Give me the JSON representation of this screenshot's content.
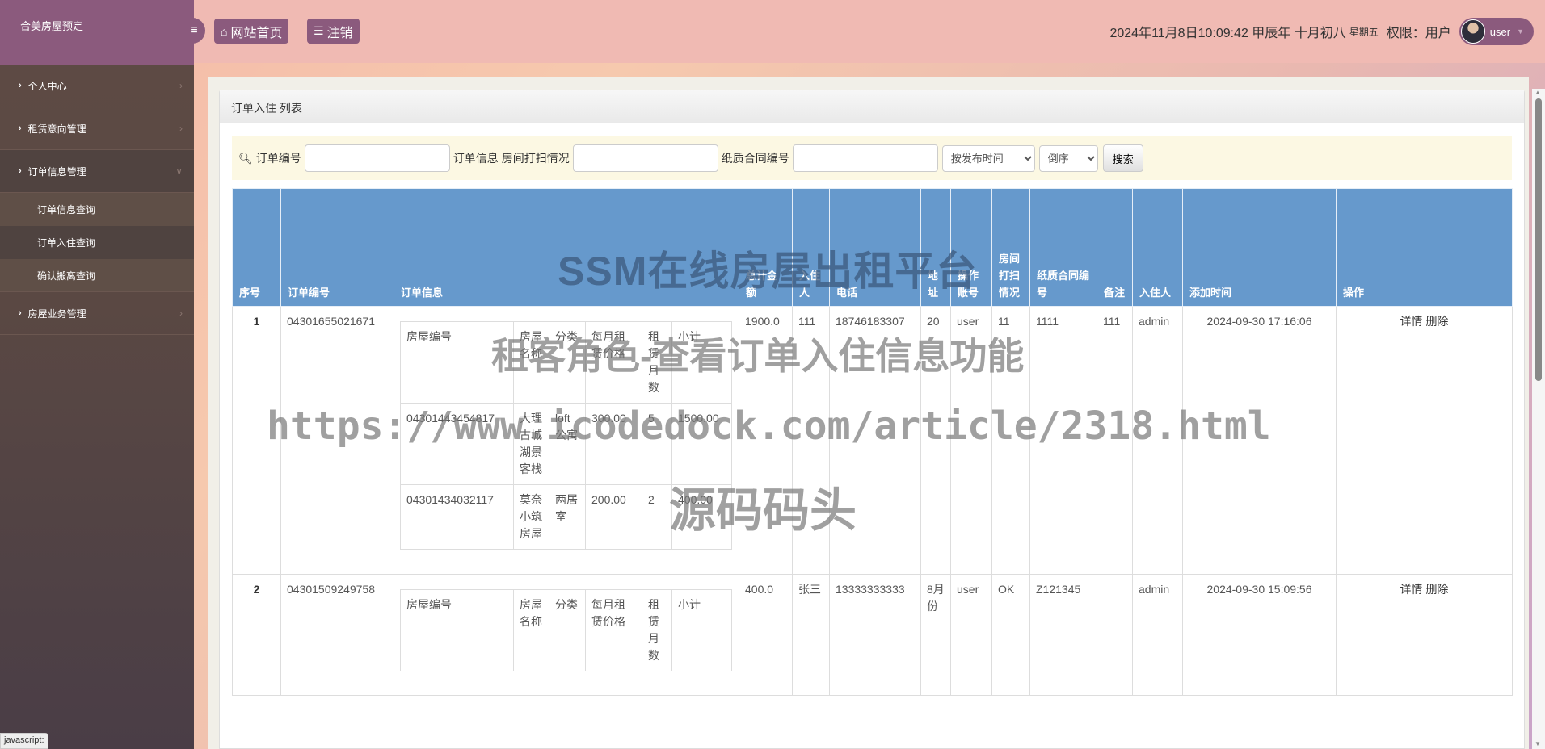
{
  "sidebar": {
    "brand": "合美房屋预定",
    "items": [
      {
        "label": "个人中心"
      },
      {
        "label": "租赁意向管理"
      },
      {
        "label": "订单信息管理",
        "sub": [
          {
            "label": "订单信息查询"
          },
          {
            "label": "订单入住查询"
          },
          {
            "label": "确认搬离查询"
          }
        ]
      },
      {
        "label": "房屋业务管理"
      }
    ]
  },
  "topbar": {
    "home_label": "网站首页",
    "logout_label": "注销",
    "datetime": "2024年11月8日10:09:42 甲辰年 十月初八",
    "weekday": "星期五",
    "permission": "权限：用户",
    "username": "user"
  },
  "panel": {
    "title": "订单入住 列表"
  },
  "search": {
    "order_no_label": "订单编号",
    "order_info_label": "订单信息",
    "clean_label": "房间打扫情况",
    "contract_label": "纸质合同编号",
    "order_no_value": "",
    "clean_value": "",
    "contract_value": "",
    "sort_field": "按发布时间",
    "sort_order": "倒序",
    "search_button": "搜索"
  },
  "table": {
    "headers": [
      "序号",
      "订单编号",
      "订单信息",
      "总计金额",
      "入住人",
      "电话",
      "地址",
      "操作账号",
      "房间打扫情况",
      "纸质合同编号",
      "备注",
      "入住人",
      "添加时间",
      "操作"
    ],
    "inner_headers": [
      "房屋编号",
      "房屋名称",
      "分类",
      "每月租赁价格",
      "租赁月数",
      "小计"
    ],
    "rows": [
      {
        "idx": "1",
        "order_no": "04301655021671",
        "items": [
          {
            "house_no": "04301443454817",
            "name": "大理古城湖景客栈",
            "category": "loft公寓",
            "price": "300.00",
            "months": "5",
            "subtotal": "1500.00"
          },
          {
            "house_no": "04301434032117",
            "name": "莫奈小筑房屋",
            "category": "两居室",
            "price": "200.00",
            "months": "2",
            "subtotal": "400.00"
          }
        ],
        "total": "1900.0",
        "occupant": "111",
        "phone": "18746183307",
        "address": "20",
        "account": "user",
        "clean": "11",
        "contract": "1111",
        "remark": "111",
        "checkin_by": "admin",
        "added": "2024-09-30 17:16:06"
      },
      {
        "idx": "2",
        "order_no": "04301509249758",
        "items": [],
        "total": "400.0",
        "occupant": "张三",
        "phone": "13333333333",
        "address": "8月份",
        "account": "user",
        "clean": "OK",
        "contract": "Z121345",
        "remark": "",
        "checkin_by": "admin",
        "added": "2024-09-30 15:09:56"
      }
    ],
    "detail_label": "详情",
    "delete_label": "删除"
  },
  "watermark": {
    "line1": "SSM在线房屋出租平台",
    "line2": "租客角色-查看订单入住信息功能",
    "line3": "https://www.icodedock.com/article/2318.html",
    "line4": "源码码头"
  },
  "status_tip": "javascript:"
}
